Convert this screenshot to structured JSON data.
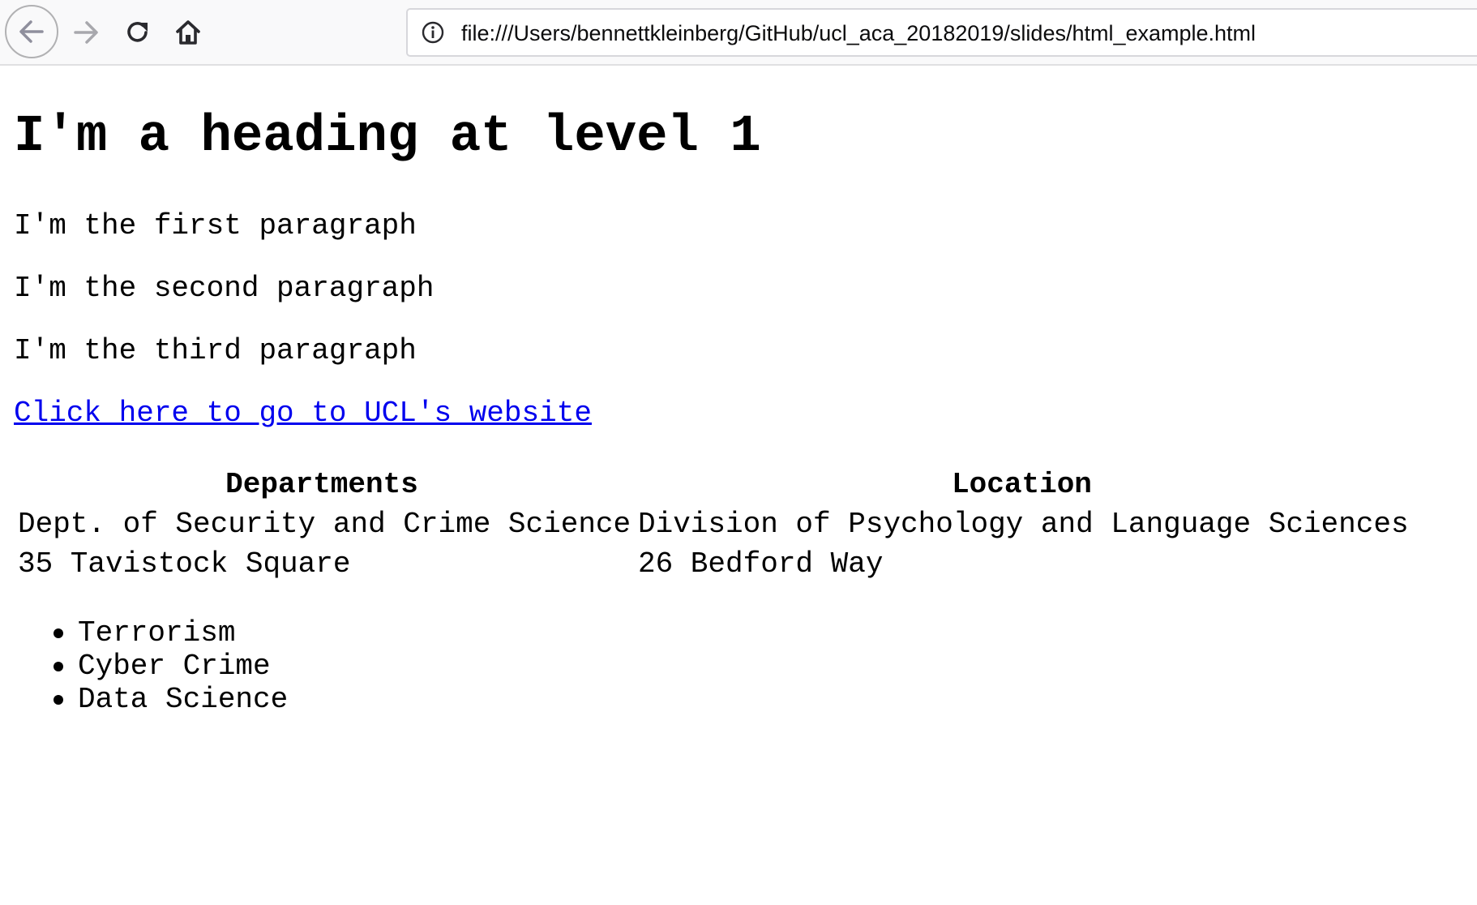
{
  "browser": {
    "url": "file:///Users/bennettkleinberg/GitHub/ucl_aca_20182019/slides/html_example.html",
    "icons": [
      "back-arrow-icon",
      "forward-arrow-icon",
      "reload-icon",
      "home-icon",
      "info-icon"
    ]
  },
  "page": {
    "heading": "I'm a heading at level 1",
    "paragraphs": [
      "I'm the first paragraph",
      "I'm the second paragraph",
      "I'm the third paragraph"
    ],
    "link_text": "Click here to go to UCL's website",
    "link_color": "#0000ee",
    "table": {
      "headers": [
        "Departments",
        "Location"
      ],
      "rows": [
        [
          "Dept. of Security and Crime Science",
          "Division of Psychology and Language Sciences"
        ],
        [
          "35 Tavistock Square",
          "26 Bedford Way"
        ]
      ]
    },
    "list": [
      "Terrorism",
      "Cyber Crime",
      "Data Science"
    ]
  }
}
